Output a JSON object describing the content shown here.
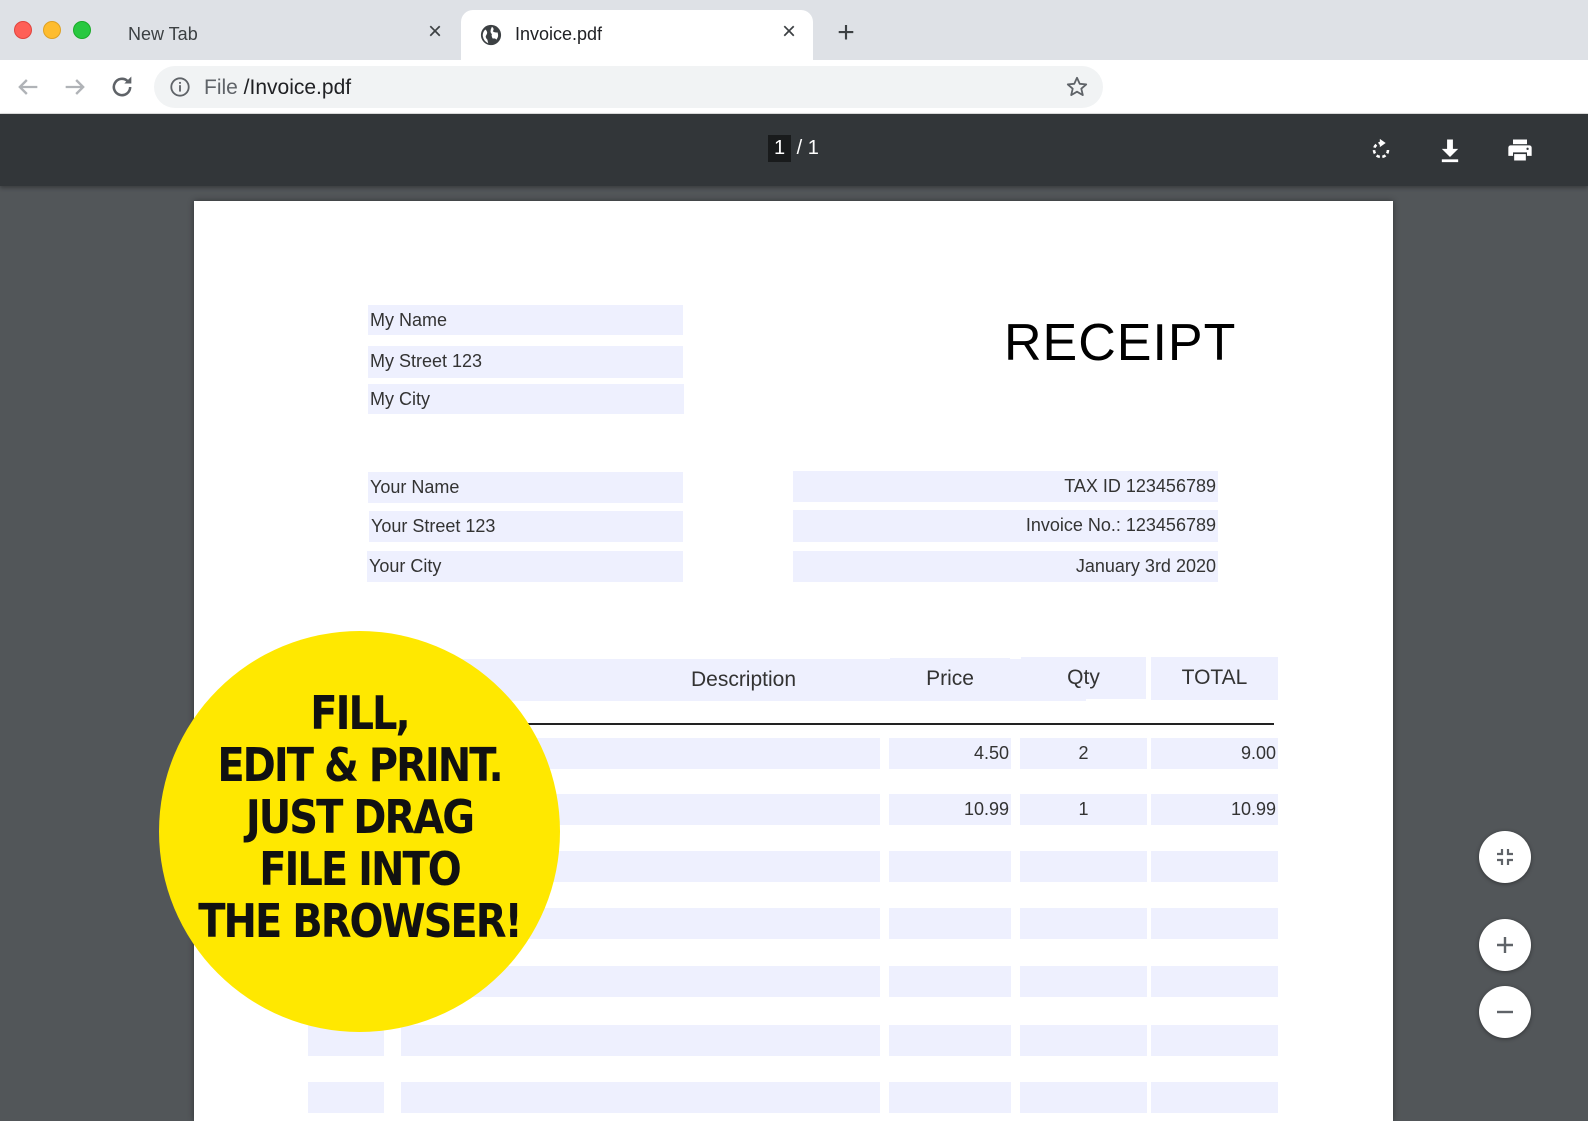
{
  "browser": {
    "tabs": [
      {
        "title": "New Tab",
        "close": "×"
      },
      {
        "title": "Invoice.pdf",
        "close": "×"
      }
    ],
    "new_tab": "+",
    "address": {
      "scheme": "File",
      "path": " /Invoice.pdf"
    }
  },
  "pdf_viewer": {
    "page_current": "1",
    "page_sep": " / ",
    "page_total": "1"
  },
  "document": {
    "title": "RECEIPT",
    "sender": [
      "My Name",
      "My Street 123",
      "My City"
    ],
    "recipient": [
      "Your Name",
      "Your Street 123",
      "Your City"
    ],
    "meta": [
      "TAX ID 123456789",
      "Invoice No.: 123456789",
      "January 3rd 2020"
    ],
    "table": {
      "headers": {
        "description": "Description",
        "price": "Price",
        "qty": "Qty",
        "total": "TOTAL"
      },
      "rows": [
        {
          "price": "4.50",
          "qty": "2",
          "total": "9.00"
        },
        {
          "price": "10.99",
          "qty": "1",
          "total": "10.99"
        },
        {
          "price": "",
          "qty": "",
          "total": ""
        },
        {
          "price": "",
          "qty": "",
          "total": ""
        },
        {
          "price": "",
          "qty": "",
          "total": ""
        },
        {
          "price": "",
          "qty": "",
          "total": ""
        },
        {
          "price": "",
          "qty": "",
          "total": ""
        }
      ]
    }
  },
  "promo": {
    "lines": [
      "FILL,",
      "EDIT &  PRINT.",
      "JUST DRAG",
      "FILE INTO",
      "THE BROWSER!"
    ],
    "color": "#ffe800"
  },
  "icons": {
    "back": "arrow-left-icon",
    "forward": "arrow-right-icon",
    "reload": "reload-icon",
    "info": "info-icon",
    "bookmark": "star-icon",
    "rotate": "rotate-icon",
    "download": "download-icon",
    "print": "printer-icon",
    "fit": "fit-to-page-icon",
    "zoom_in": "plus-icon",
    "zoom_out": "minus-icon"
  }
}
